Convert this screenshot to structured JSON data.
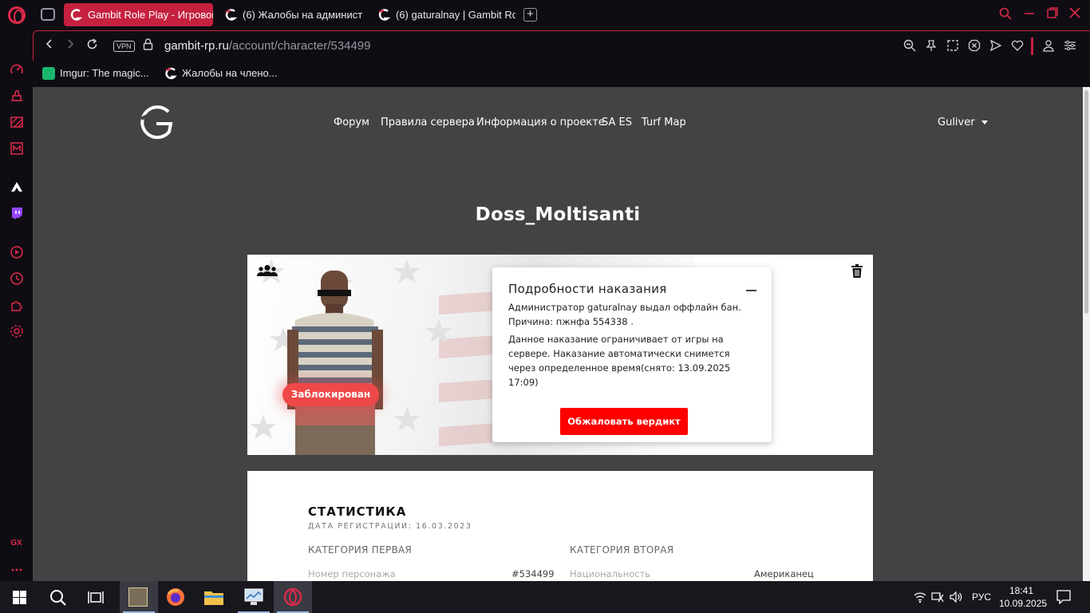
{
  "browser": {
    "tabs": [
      {
        "title": "Gambit Role Play - Игровой",
        "active": true
      },
      {
        "title": "(6) Жалобы на админист",
        "active": false
      },
      {
        "title": "(6) gaturalnay | Gambit Ro",
        "active": false
      }
    ],
    "new_tab_label": "+",
    "address": {
      "vpn_label": "VPN",
      "host": "gambit-rp.ru",
      "path": "/account/character/534499"
    },
    "bookmarks": [
      {
        "label": "Imgur: The magic..."
      },
      {
        "label": "Жалобы на члено..."
      }
    ],
    "sidebar_bottom_label": "GX",
    "accent_color": "#e0294b"
  },
  "site": {
    "nav": [
      "Форум",
      "Правила сервера",
      "Информация о проекте",
      "SA ES",
      "Turf Map"
    ],
    "username": "Guliver",
    "character_name": "Doss_Moltisanti",
    "status_badge": "Заблокирован",
    "punishment": {
      "title": "Подробности наказания",
      "line1": "Администратор gaturalnay выдал оффлайн бан.",
      "line2": "Причина: пжнфа 554338 .",
      "details": "Данное наказание ограничивает от игры на сервере. Наказание автоматически снимется через определенное время(снято: 13.09.2025 17:09)",
      "appeal_button": "Обжаловать вердикт"
    },
    "stats": {
      "title": "СТАТИСТИКА",
      "registration": "ДАТА РЕГИСТРАЦИИ: 16.03.2023",
      "category1": "КАТЕГОРИЯ ПЕРВАЯ",
      "category2": "КАТЕГОРИЯ ВТОРАЯ",
      "rows": [
        {
          "key1": "Номер персонажа",
          "val1": "#534499",
          "key2": "Национальность",
          "val2": "Американец"
        }
      ]
    }
  },
  "taskbar": {
    "lang": "РУС",
    "time": "18:41",
    "date": "10.09.2025"
  }
}
